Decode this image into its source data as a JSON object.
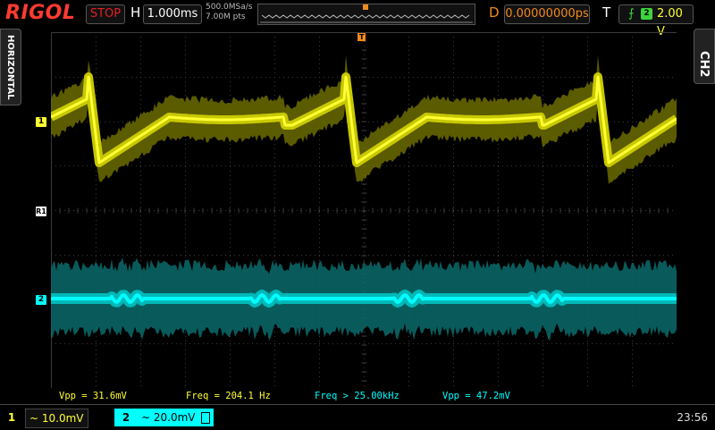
{
  "header": {
    "brand": "RIGOL",
    "run_status": "STOP",
    "horizontal_label": "H",
    "timebase": "1.000ms",
    "sample_rate": "500.0MSa/s",
    "memory_depth": "7.00M pts",
    "delay_label": "D",
    "delay_value": "0.00000000ps",
    "trigger_label": "T",
    "trigger_source": "2",
    "trigger_level": "2.00 V"
  },
  "side": {
    "left_tab": "HORIZONTAL",
    "right_tab": "CH2"
  },
  "markers": {
    "ch1": "1",
    "ch2": "2",
    "ref": "R1",
    "trigger_position": "T"
  },
  "measurements": [
    {
      "text": "Vpp = 31.6mV",
      "color": "#ffff33"
    },
    {
      "text": "Freq = 204.1 Hz",
      "color": "#ffff33"
    },
    {
      "text": "Freq > 25.00kHz",
      "color": "#00ffff"
    },
    {
      "text": "Vpp = 47.2mV",
      "color": "#00ffff"
    }
  ],
  "channels": [
    {
      "number": "1",
      "coupling_icon": "ac-coupling-icon",
      "scale": "~ 10.0mV",
      "color": "#ffff33"
    },
    {
      "number": "2",
      "coupling_icon": "ac-coupling-icon",
      "scale": "~ 20.0mV",
      "color": "#00ffff"
    }
  ],
  "clock": "23:56",
  "colors": {
    "ch1": "#ffff33",
    "ch1_envelope": "#6b6b00",
    "ch2": "#00ffff",
    "ch2_envelope": "#0a6b6b",
    "accent": "#f28a1a",
    "brand": "#ff3b2f",
    "grid": "#3a3a3a"
  }
}
